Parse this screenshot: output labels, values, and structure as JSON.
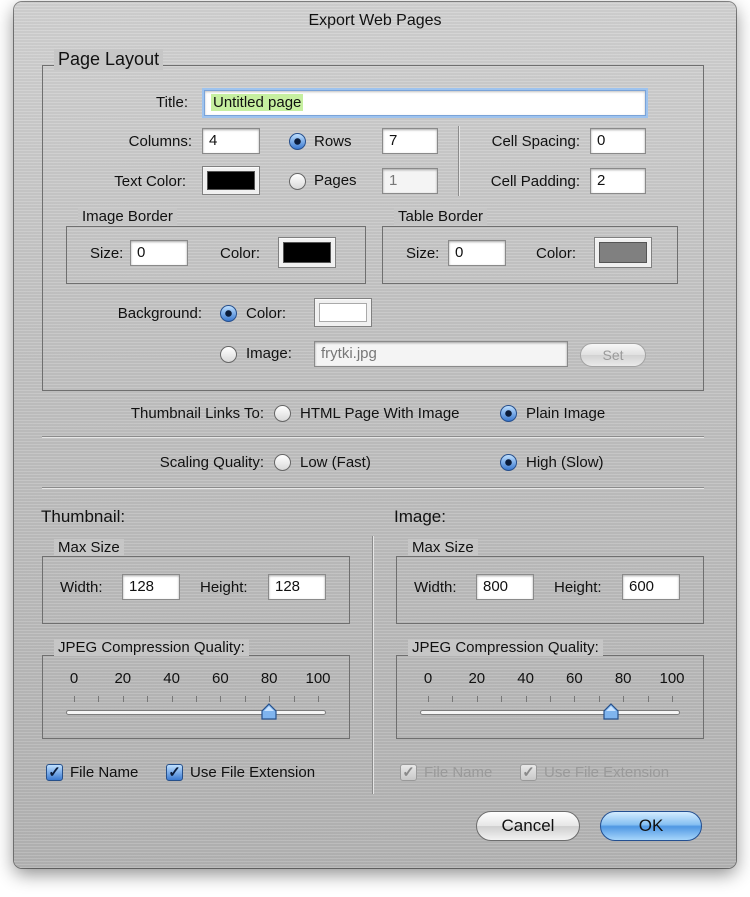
{
  "window": {
    "title": "Export Web Pages"
  },
  "page_layout": {
    "legend": "Page Layout",
    "title_label": "Title:",
    "title_value": "Untitled page",
    "columns_label": "Columns:",
    "columns_value": "4",
    "rows_label": "Rows",
    "rows_value": "7",
    "rows_selected": true,
    "pages_label": "Pages",
    "pages_value": "1",
    "text_color_label": "Text Color:",
    "text_color": "#000000",
    "cell_spacing_label": "Cell Spacing:",
    "cell_spacing_value": "0",
    "cell_padding_label": "Cell Padding:",
    "cell_padding_value": "2",
    "image_border": {
      "legend": "Image Border",
      "size_label": "Size:",
      "size_value": "0",
      "color_label": "Color:",
      "color": "#000000"
    },
    "table_border": {
      "legend": "Table Border",
      "size_label": "Size:",
      "size_value": "0",
      "color_label": "Color:",
      "color": "#808080"
    },
    "background_label": "Background:",
    "bg_color_label": "Color:",
    "bg_color": "#ffffff",
    "bg_image_label": "Image:",
    "bg_image_value": "frytki.jpg",
    "set_button": "Set",
    "background_mode": "color"
  },
  "thumbnail_links": {
    "label": "Thumbnail Links To:",
    "option_html": "HTML Page With Image",
    "option_plain": "Plain Image",
    "selected": "plain"
  },
  "scaling": {
    "label": "Scaling Quality:",
    "option_low": "Low (Fast)",
    "option_high": "High (Slow)",
    "selected": "high"
  },
  "thumbnail": {
    "heading": "Thumbnail:",
    "max_size_legend": "Max Size",
    "width_label": "Width:",
    "width_value": "128",
    "height_label": "Height:",
    "height_value": "128",
    "jpeg_legend": "JPEG Compression Quality:",
    "scale": [
      "0",
      "20",
      "40",
      "60",
      "80",
      "100"
    ],
    "quality": 80,
    "file_name_label": "File Name",
    "file_name_checked": true,
    "use_ext_label": "Use File Extension",
    "use_ext_checked": true
  },
  "image": {
    "heading": "Image:",
    "max_size_legend": "Max Size",
    "width_label": "Width:",
    "width_value": "800",
    "height_label": "Height:",
    "height_value": "600",
    "jpeg_legend": "JPEG Compression Quality:",
    "scale": [
      "0",
      "20",
      "40",
      "60",
      "80",
      "100"
    ],
    "quality": 75,
    "file_name_label": "File Name",
    "file_name_checked": true,
    "use_ext_label": "Use File Extension",
    "use_ext_checked": true
  },
  "buttons": {
    "cancel": "Cancel",
    "ok": "OK"
  }
}
